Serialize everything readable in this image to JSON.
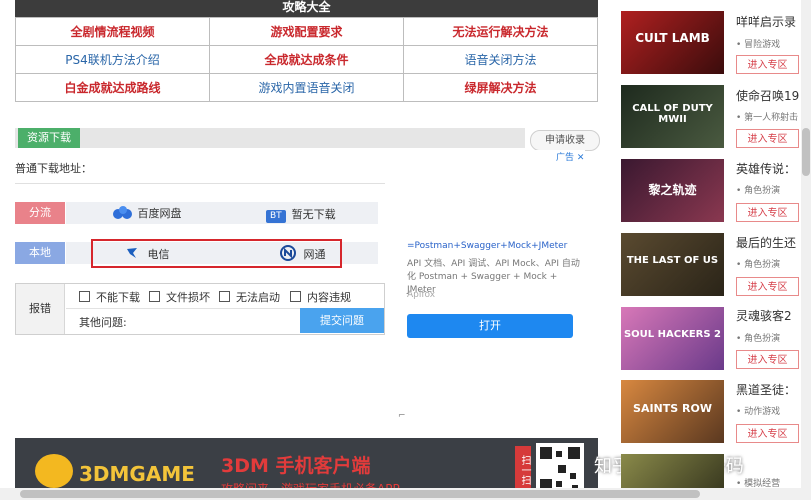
{
  "guide": {
    "title": "攻略大全",
    "rows": [
      [
        "全剧情流程视频",
        "游戏配置要求",
        "无法运行解决方法"
      ],
      [
        "PS4联机方法介绍",
        "全成就达成条件",
        "语音关闭方法"
      ],
      [
        "白金成就达成路线",
        "游戏内置语音关闭",
        "绿屏解决方法"
      ]
    ]
  },
  "resource": {
    "tag": "资源下载",
    "apply_button": "申请收录",
    "address_label": "普通下载地址：",
    "split_tag": "分流",
    "baidu": "百度网盘",
    "bt_badge": "BT",
    "bt_label": "暂无下载",
    "local_tag": "本地",
    "telecom": "电信",
    "netcom": "网通"
  },
  "report": {
    "label": "报错",
    "options": [
      "不能下载",
      "文件损坏",
      "无法启动",
      "内容违规"
    ],
    "other_label": "其他问题:",
    "submit": "提交问题"
  },
  "ad": {
    "badge": "广告",
    "title": "=Postman+Swagger+Mock+JMeter",
    "desc": "API 文档、API 调试、API Mock、API 自动化 Postman + Swagger + Mock + JMeter",
    "brand": "Apifox",
    "button": "打开"
  },
  "banner": {
    "logo": "3DMGAME",
    "headline": "3DM 手机客户端",
    "sub": "攻略问来、游戏玩家手机必备APP",
    "scan": "扫一扫",
    "watermark": "知乎 @假装是条码"
  },
  "games": [
    {
      "title": "咩咩启示录",
      "genre": "冒险游戏",
      "button": "进入专区",
      "thumb_text": "CULT LAMB",
      "colors": [
        "#b02020",
        "#3a0c0c"
      ]
    },
    {
      "title": "使命召唤19",
      "genre": "第一人称射击",
      "button": "进入专区",
      "thumb_text": "CALL OF DUTY MWII",
      "colors": [
        "#1e2a1e",
        "#4a5a40"
      ]
    },
    {
      "title": "英雄传说：",
      "genre": "角色扮演",
      "button": "进入专区",
      "thumb_text": "黎之轨迹",
      "colors": [
        "#3a1830",
        "#8a3850"
      ]
    },
    {
      "title": "最后的生还",
      "genre": "角色扮演",
      "button": "进入专区",
      "thumb_text": "THE LAST OF US",
      "colors": [
        "#5a4a30",
        "#2a2418"
      ]
    },
    {
      "title": "灵魂骇客2",
      "genre": "角色扮演",
      "button": "进入专区",
      "thumb_text": "SOUL HACKERS 2",
      "colors": [
        "#d878b8",
        "#6a3a8a"
      ]
    },
    {
      "title": "黑道圣徒：",
      "genre": "动作游戏",
      "button": "进入专区",
      "thumb_text": "SAINTS ROW",
      "colors": [
        "#d88840",
        "#5a3820"
      ]
    }
  ],
  "game_partial": {
    "genre": "模拟经营"
  },
  "colors": {
    "accent_red": "#c9282d",
    "accent_blue": "#2a66a8",
    "green_tag": "#4caf6a",
    "submit_blue": "#4aa3ee"
  }
}
